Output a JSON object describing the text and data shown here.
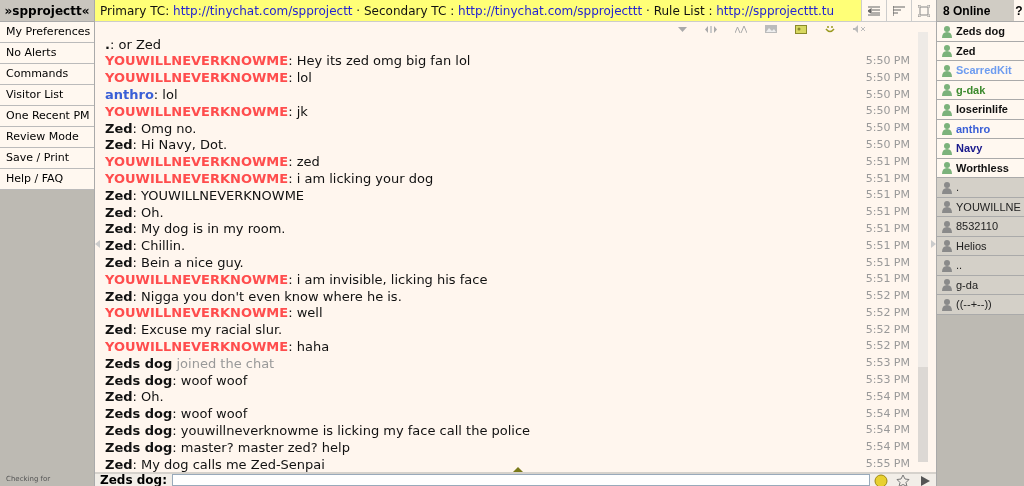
{
  "sidebar": {
    "title": "»spprojectt«",
    "items": [
      "My Preferences",
      "No Alerts",
      "Commands",
      "Visitor List",
      "One Recent PM",
      "Review Mode",
      "Save / Print",
      "Help / FAQ"
    ],
    "footer": "Checking for"
  },
  "topic": [
    {
      "kind": "text",
      "text": "Primary TC: "
    },
    {
      "kind": "link",
      "text": "http://tinychat.com/spprojectt"
    },
    {
      "kind": "text",
      "text": " · Secondary TC : "
    },
    {
      "kind": "link",
      "text": "http://tinychat.com/spprojecttt"
    },
    {
      "kind": "text",
      "text": " · Rule List : "
    },
    {
      "kind": "link",
      "text": "http://spprojecttt.tu"
    }
  ],
  "messages": [
    {
      "kind": "message",
      "name": ".",
      "text": ": or Zed"
    },
    {
      "kind": "message",
      "name": "YOUWILLNEVERKNOWME",
      "color": "#ff4d4d",
      "text": ": Hey its zed omg big fan lol",
      "time": "5:50 PM"
    },
    {
      "kind": "message",
      "name": "YOUWILLNEVERKNOWME",
      "color": "#ff4d4d",
      "text": ": lol",
      "time": "5:50 PM"
    },
    {
      "kind": "message",
      "name": "anthro",
      "color": "#3a5fd6",
      "text": ": lol",
      "time": "5:50 PM"
    },
    {
      "kind": "message",
      "name": "YOUWILLNEVERKNOWME",
      "color": "#ff4d4d",
      "text": ": jk",
      "time": "5:50 PM"
    },
    {
      "kind": "message",
      "name": "Zed",
      "color": "#111111",
      "text": ": Omg no.",
      "time": "5:50 PM"
    },
    {
      "kind": "message",
      "name": "Zed",
      "color": "#111111",
      "text": ": Hi Navy, Dot.",
      "time": "5:50 PM"
    },
    {
      "kind": "message",
      "name": "YOUWILLNEVERKNOWME",
      "color": "#ff4d4d",
      "text": ": zed",
      "time": "5:51 PM"
    },
    {
      "kind": "message",
      "name": "YOUWILLNEVERKNOWME",
      "color": "#ff4d4d",
      "text": ": i am licking your dog",
      "time": "5:51 PM"
    },
    {
      "kind": "message",
      "name": "Zed",
      "color": "#111111",
      "text": ": YOUWILLNEVERKNOWME",
      "time": "5:51 PM"
    },
    {
      "kind": "message",
      "name": "Zed",
      "color": "#111111",
      "text": ": Oh.",
      "time": "5:51 PM"
    },
    {
      "kind": "message",
      "name": "Zed",
      "color": "#111111",
      "text": ": My dog is in my room.",
      "time": "5:51 PM"
    },
    {
      "kind": "message",
      "name": "Zed",
      "color": "#111111",
      "text": ": Chillin.",
      "time": "5:51 PM"
    },
    {
      "kind": "message",
      "name": "Zed",
      "color": "#111111",
      "text": ": Bein a nice guy.",
      "time": "5:51 PM"
    },
    {
      "kind": "message",
      "name": "YOUWILLNEVERKNOWME",
      "color": "#ff4d4d",
      "text": ": i am invisible, licking his face",
      "time": "5:51 PM"
    },
    {
      "kind": "message",
      "name": "Zed",
      "color": "#111111",
      "text": ": Nigga you don't even know where he is.",
      "time": "5:52 PM"
    },
    {
      "kind": "message",
      "name": "YOUWILLNEVERKNOWME",
      "color": "#ff4d4d",
      "text": ": well",
      "time": "5:52 PM"
    },
    {
      "kind": "message",
      "name": "Zed",
      "color": "#111111",
      "text": ": Excuse my racial slur.",
      "time": "5:52 PM"
    },
    {
      "kind": "message",
      "name": "YOUWILLNEVERKNOWME",
      "color": "#ff4d4d",
      "text": ": haha",
      "time": "5:52 PM"
    },
    {
      "kind": "join",
      "name": "Zeds dog",
      "color": "#111111",
      "text": " joined the chat",
      "time": "5:53 PM"
    },
    {
      "kind": "message",
      "name": "Zeds dog",
      "color": "#111111",
      "text": ": woof woof",
      "time": "5:53 PM"
    },
    {
      "kind": "message",
      "name": "Zed",
      "color": "#111111",
      "text": ": Oh.",
      "time": "5:54 PM"
    },
    {
      "kind": "message",
      "name": "Zeds dog",
      "color": "#111111",
      "text": ": woof woof",
      "time": "5:54 PM"
    },
    {
      "kind": "message",
      "name": "Zeds dog",
      "color": "#111111",
      "text": ": youwillneverknowme is licking my face call the police",
      "time": "5:54 PM"
    },
    {
      "kind": "message",
      "name": "Zeds dog",
      "color": "#111111",
      "text": ": master? master zed? help",
      "time": "5:54 PM"
    },
    {
      "kind": "message",
      "name": "Zed",
      "color": "#111111",
      "text": ": My dog calls me Zed-Senpai",
      "time": "5:55 PM"
    }
  ],
  "input": {
    "label": "Zeds dog:"
  },
  "userlist": {
    "title": "8 Online",
    "help": "?",
    "users": [
      {
        "name": "Zeds dog",
        "color": "#111111",
        "idle": false
      },
      {
        "name": "Zed",
        "color": "#111111",
        "idle": false
      },
      {
        "name": "ScarredKit",
        "color": "#6d9cf0",
        "idle": false
      },
      {
        "name": "g-dak",
        "color": "#3c8a2e",
        "idle": false
      },
      {
        "name": "loserinlife",
        "color": "#111111",
        "idle": false
      },
      {
        "name": "anthro",
        "color": "#3a5fd6",
        "idle": false
      },
      {
        "name": "Navy",
        "color": "#1a1a8c",
        "idle": false
      },
      {
        "name": "Worthless",
        "color": "#111111",
        "idle": false
      },
      {
        "name": ".",
        "idle": true
      },
      {
        "name": "YOUWILLNE",
        "idle": true
      },
      {
        "name": "8532110",
        "idle": true
      },
      {
        "name": "Helios",
        "idle": true
      },
      {
        "name": "..",
        "idle": true
      },
      {
        "name": "g-da",
        "idle": true
      },
      {
        "name": "((--+--))",
        "idle": true
      }
    ]
  }
}
